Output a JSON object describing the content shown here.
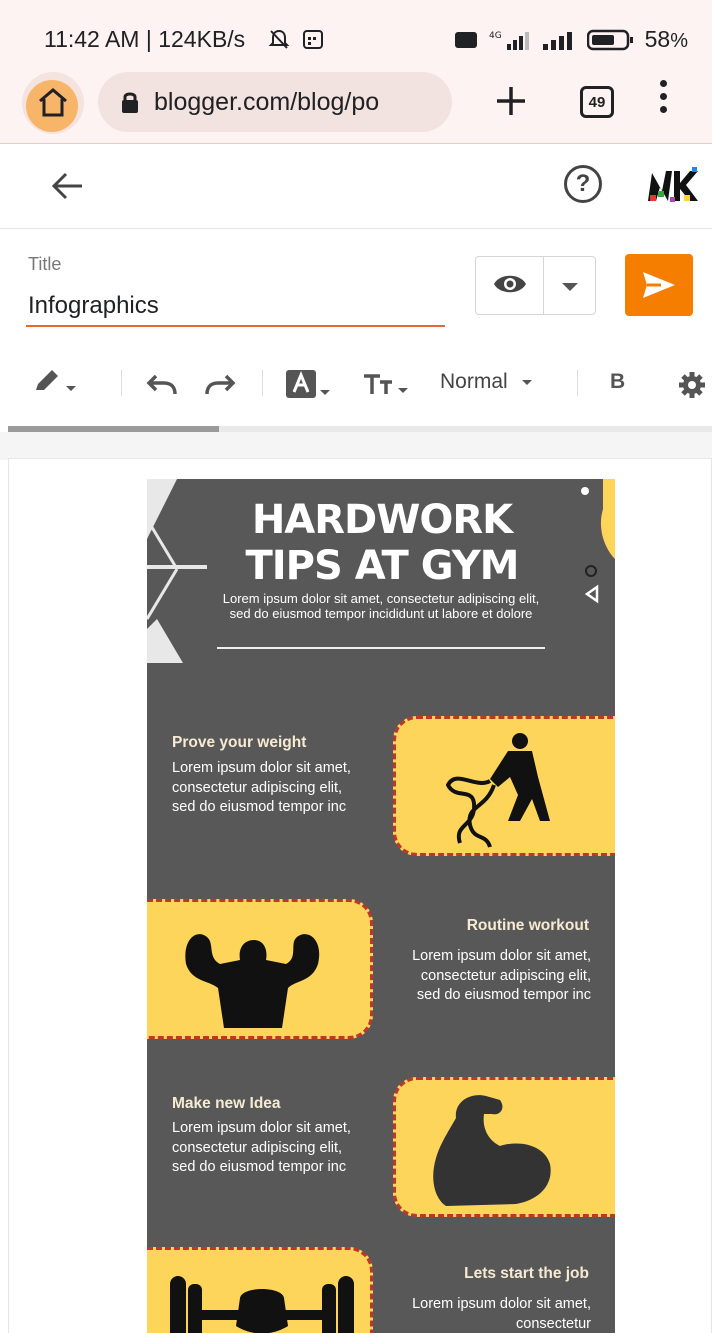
{
  "status_bar": {
    "time": "11:42 AM | 124KB/s",
    "battery": "58",
    "battery_unit": "%"
  },
  "browser": {
    "url": "blogger.com/blog/po",
    "tab_count": "49",
    "icons": [
      "home-icon",
      "lock-icon",
      "plus-icon",
      "tabs-icon",
      "more-icon"
    ]
  },
  "editor_header": {
    "icons": [
      "back-arrow-icon",
      "help-icon",
      "avatar"
    ]
  },
  "post": {
    "title_label": "Title",
    "title_value": "Infographics"
  },
  "toolbar": {
    "paragraph_style": "Normal",
    "bold_label": "B",
    "progress_fraction": 0.3
  },
  "infographic": {
    "title_line1": "HARDWORK",
    "title_line2": "TIPS AT GYM",
    "subtitle": "Lorem ipsum dolor sit amet, consectetur adipiscing elit, sed do eiusmod tempor incididunt ut labore et dolore",
    "sections": [
      {
        "title": "Prove your weight",
        "body": "Lorem ipsum dolor sit amet, consectetur adipiscing elit, sed do eiusmod tempor inc"
      },
      {
        "title": "Routine workout",
        "body": "Lorem ipsum dolor sit amet, consectetur adipiscing elit, sed do eiusmod tempor inc"
      },
      {
        "title": "Make new Idea",
        "body": "Lorem ipsum dolor sit amet, consectetur adipiscing elit, sed do eiusmod tempor inc"
      },
      {
        "title": "Lets start the job",
        "body": "Lorem ipsum dolor sit amet, consectetur"
      }
    ],
    "colors": {
      "background": "#585858",
      "panel": "#fdd55a",
      "dash": "#c0362c"
    }
  }
}
